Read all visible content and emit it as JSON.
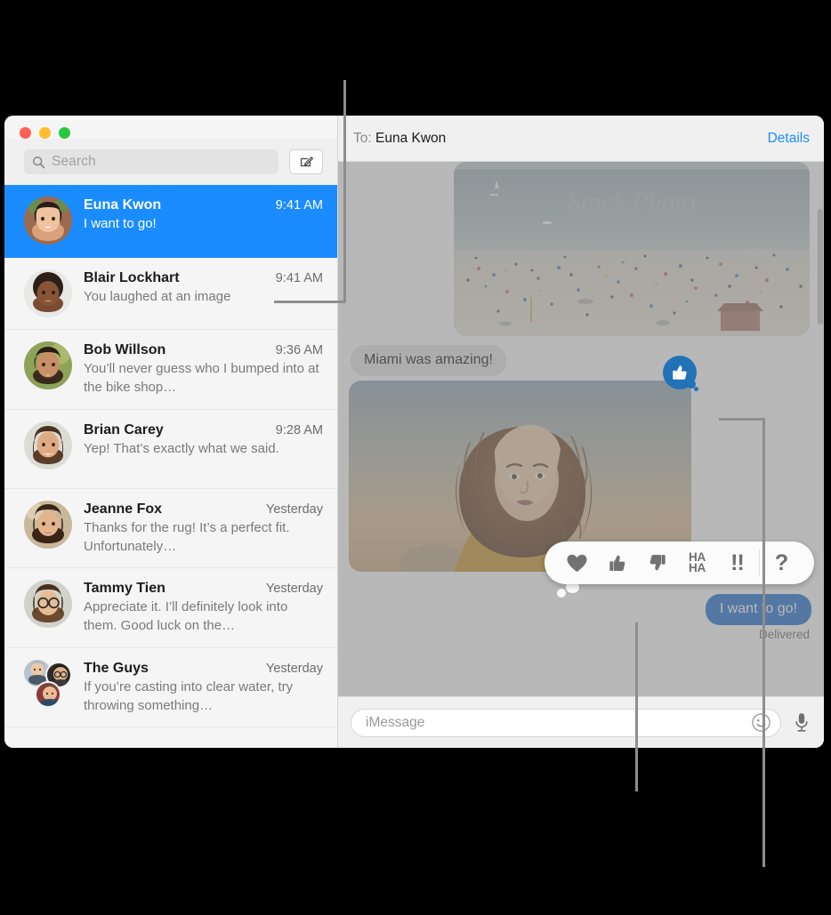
{
  "window": {
    "traffic_lights": [
      {
        "name": "close",
        "color": "#ff5f57"
      },
      {
        "name": "minimize",
        "color": "#ffbd2e"
      },
      {
        "name": "zoom",
        "color": "#28c840"
      }
    ]
  },
  "sidebar": {
    "search": {
      "placeholder": "Search",
      "value": ""
    },
    "compose_button_label": "New Message",
    "conversations": [
      {
        "name": "Euna Kwon",
        "time": "9:41 AM",
        "preview": "I want to go!",
        "selected": true,
        "avatar_kind": "single"
      },
      {
        "name": "Blair Lockhart",
        "time": "9:41 AM",
        "preview": "You laughed at an image",
        "selected": false,
        "avatar_kind": "single"
      },
      {
        "name": "Bob Willson",
        "time": "9:36 AM",
        "preview": "You’ll never guess who I bumped into at the bike shop…",
        "selected": false,
        "avatar_kind": "single"
      },
      {
        "name": "Brian Carey",
        "time": "9:28 AM",
        "preview": "Yep! That’s exactly what we said.",
        "selected": false,
        "avatar_kind": "single"
      },
      {
        "name": "Jeanne Fox",
        "time": "Yesterday",
        "preview": "Thanks for the rug! It’s a perfect fit. Unfortunately…",
        "selected": false,
        "avatar_kind": "single"
      },
      {
        "name": "Tammy Tien",
        "time": "Yesterday",
        "preview": "Appreciate it. I’ll definitely look into them. Good luck on the…",
        "selected": false,
        "avatar_kind": "single"
      },
      {
        "name": "The Guys",
        "time": "Yesterday",
        "preview": "If you’re casting into clear water, try throwing something…",
        "selected": false,
        "avatar_kind": "group"
      }
    ]
  },
  "conversation": {
    "to_label": "To:",
    "recipient": "Euna Kwon",
    "details_label": "Details",
    "messages": [
      {
        "type": "image",
        "direction": "incoming",
        "description": "Crowded beach with ocean and sailboats"
      },
      {
        "type": "text",
        "direction": "incoming",
        "text": "Miami was amazing!"
      },
      {
        "type": "image",
        "direction": "incoming",
        "description": "Woman with curly hair in yellow scarf at sunset"
      },
      {
        "type": "text",
        "direction": "outgoing",
        "text": "I want to go!",
        "status": "Delivered"
      }
    ],
    "delivered_label": "Delivered",
    "reaction_badge": {
      "icon": "thumbs-up-icon",
      "color": "#2272b8"
    }
  },
  "tapback": {
    "items": [
      {
        "name": "heart",
        "icon": "heart-icon",
        "label": ""
      },
      {
        "name": "thumbs-up",
        "icon": "thumbs-up-icon",
        "label": ""
      },
      {
        "name": "thumbs-down",
        "icon": "thumbs-down-icon",
        "label": ""
      },
      {
        "name": "haha",
        "icon": "haha-icon",
        "label": "HA\nHA"
      },
      {
        "name": "exclamation",
        "icon": "exclamation-icon",
        "label": "!!"
      },
      {
        "name": "question",
        "icon": "question-icon",
        "label": "?"
      }
    ],
    "haha_line1": "HA",
    "haha_line2": "HA",
    "exclamation_label": "!!",
    "question_label": "?"
  },
  "composer": {
    "placeholder": "iMessage",
    "value": "",
    "emoji_button": "emoji-icon",
    "mic_button": "microphone-icon"
  },
  "colors": {
    "accent_blue": "#1a8cff",
    "bubble_out": "#1c6fd0",
    "bubble_in": "#e6e6e6",
    "badge_blue": "#2272b8"
  }
}
